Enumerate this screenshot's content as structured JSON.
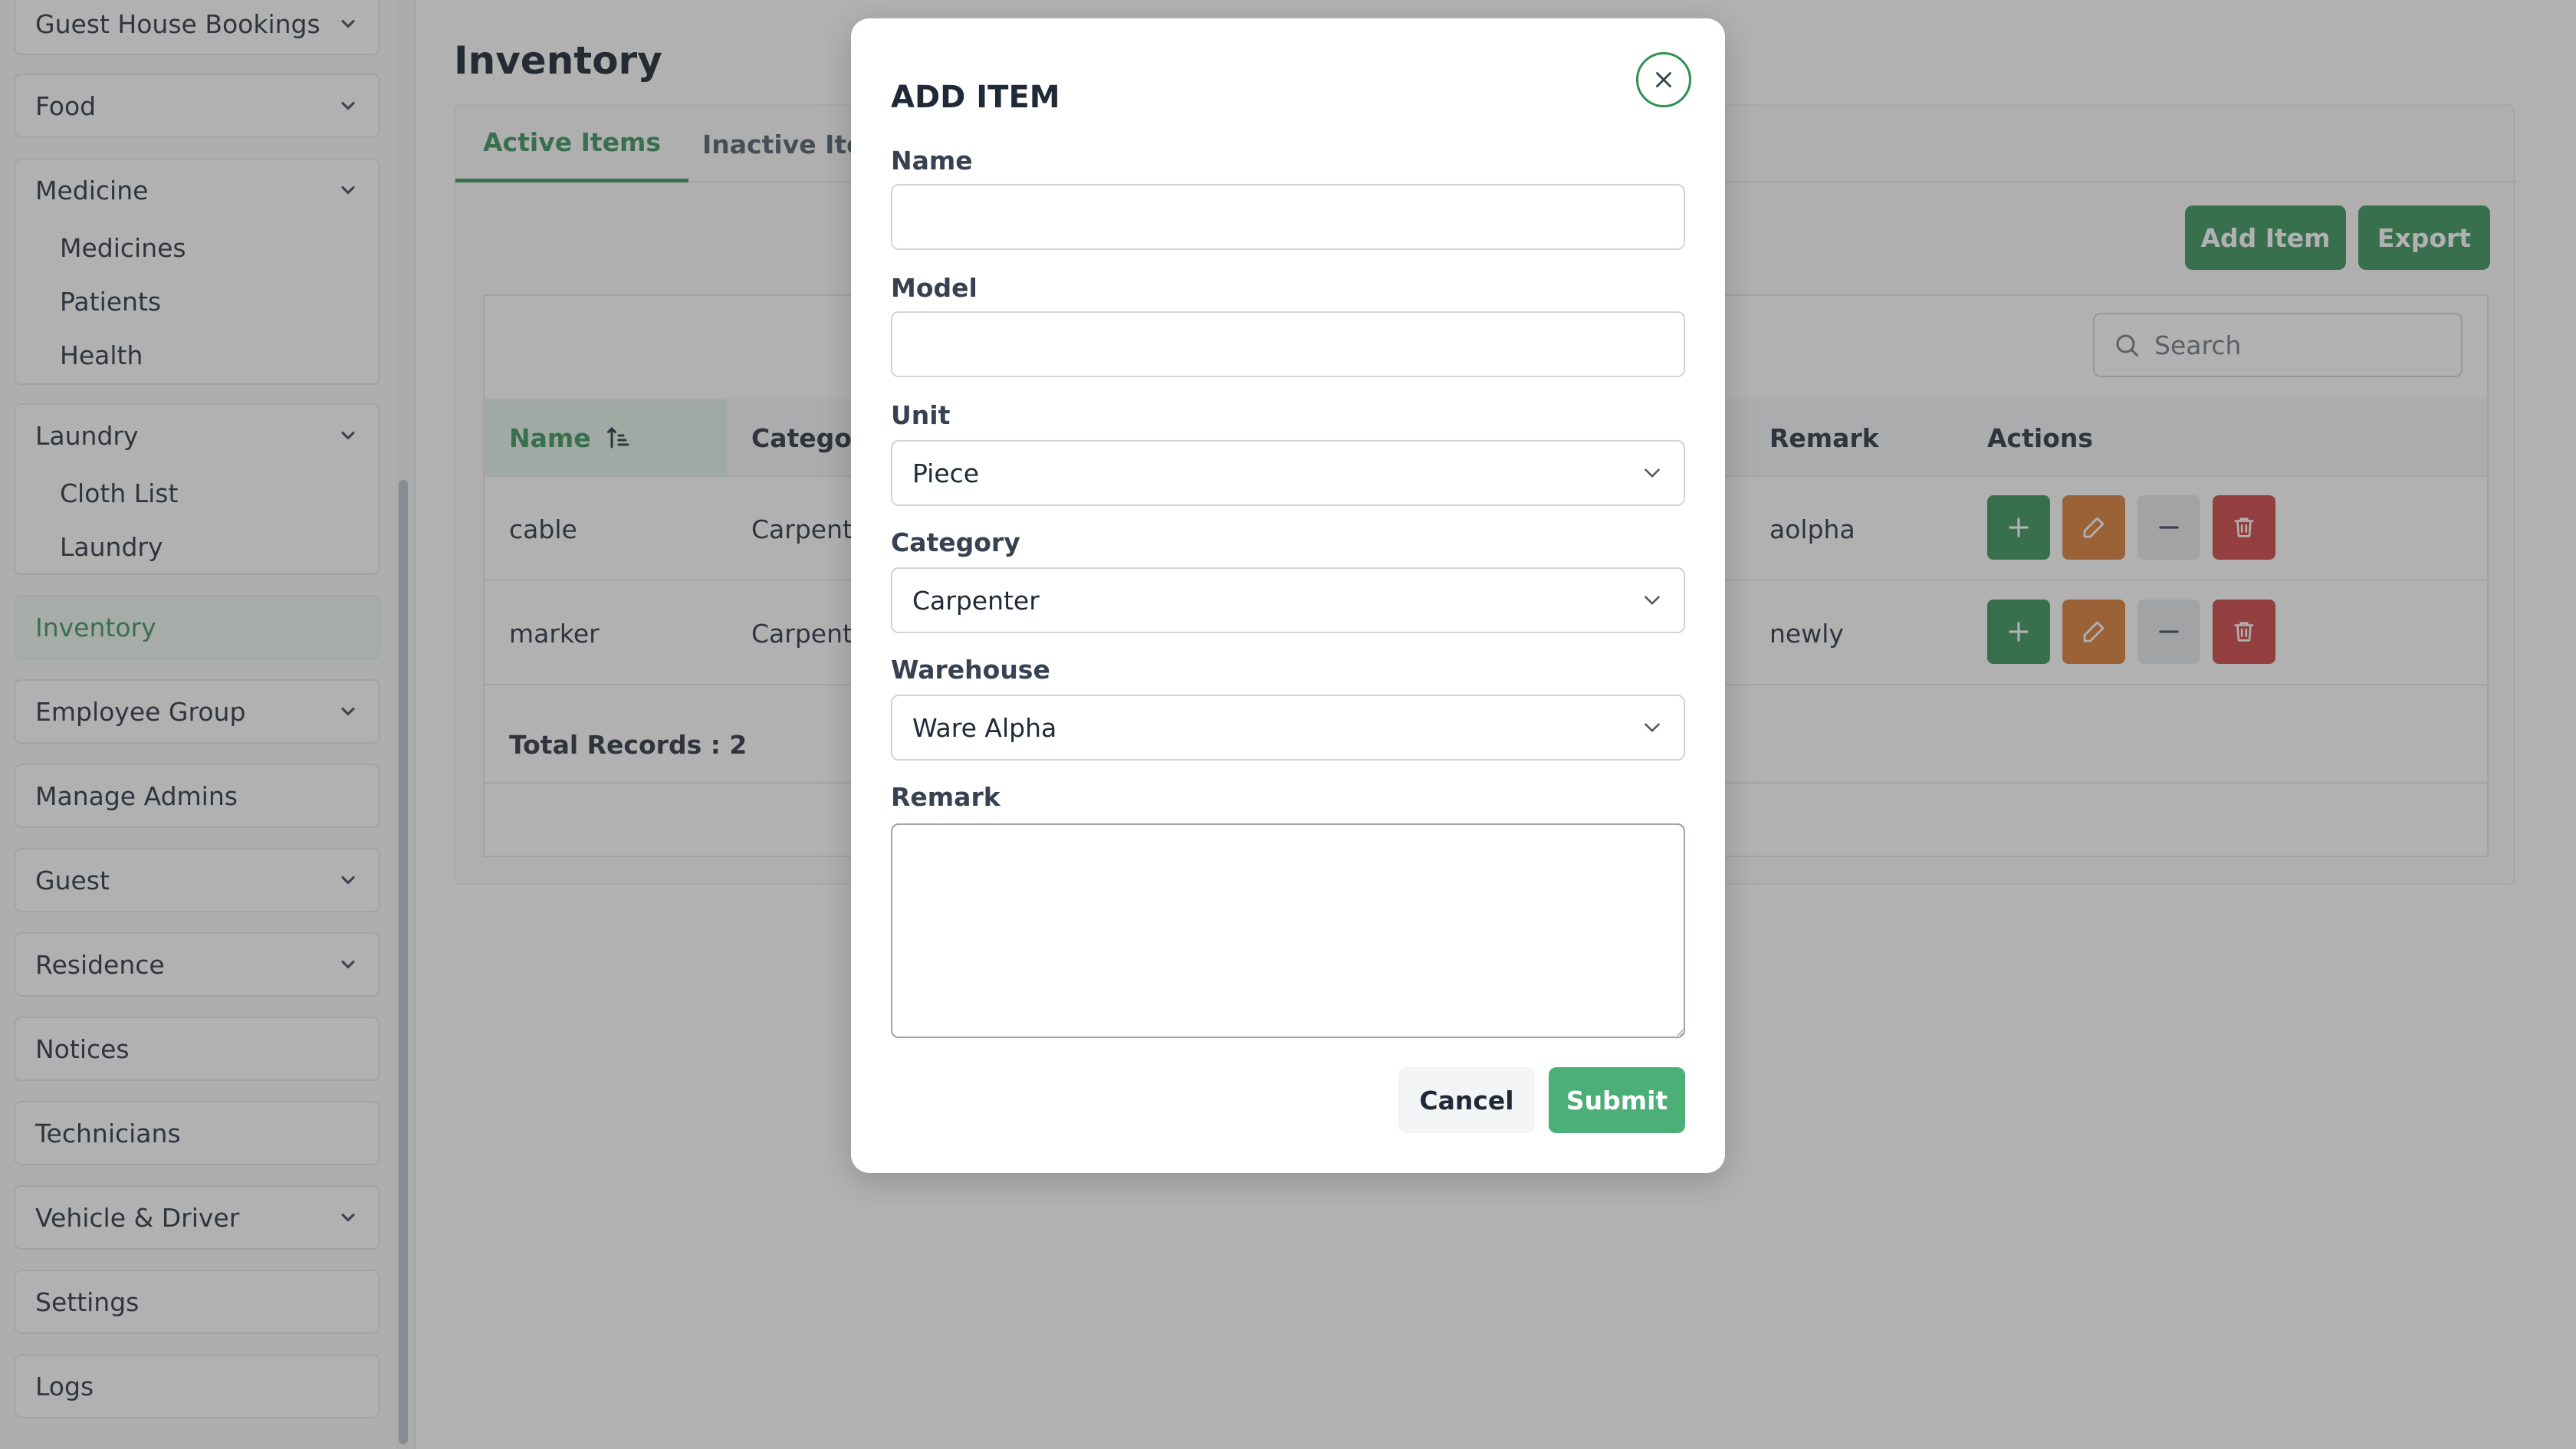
{
  "sidebar": {
    "groups": [
      {
        "label": "Guest House Bookings",
        "has_chevron": true
      },
      {
        "label": "Food",
        "has_chevron": true
      },
      {
        "label": "Medicine",
        "has_chevron": true,
        "children": [
          "Medicines",
          "Patients",
          "Health"
        ]
      },
      {
        "label": "Laundry",
        "has_chevron": true,
        "children": [
          "Cloth List",
          "Laundry"
        ]
      },
      {
        "label": "Inventory",
        "active": true
      },
      {
        "label": "Employee Group",
        "has_chevron": true
      },
      {
        "label": "Manage Admins"
      },
      {
        "label": "Guest",
        "has_chevron": true
      },
      {
        "label": "Residence",
        "has_chevron": true
      },
      {
        "label": "Notices"
      },
      {
        "label": "Technicians"
      },
      {
        "label": "Vehicle & Driver",
        "has_chevron": true
      },
      {
        "label": "Settings"
      },
      {
        "label": "Logs"
      }
    ]
  },
  "main": {
    "title": "Inventory",
    "tabs": [
      {
        "label": "Active Items",
        "active": true
      },
      {
        "label": "Inactive Items"
      }
    ],
    "buttons": {
      "add_item": "Add Item",
      "export": "Export"
    },
    "search": {
      "placeholder": "Search"
    },
    "table": {
      "columns": [
        "Name",
        "Category",
        "Remark",
        "Actions"
      ],
      "rows": [
        {
          "name": "cable",
          "category": "Carpenter",
          "remark": "aolpha"
        },
        {
          "name": "marker",
          "category": "Carpenter",
          "remark": "newly"
        }
      ],
      "total_label": "Total Records : 2"
    }
  },
  "modal": {
    "title": "ADD ITEM",
    "fields": {
      "name_label": "Name",
      "model_label": "Model",
      "unit_label": "Unit",
      "unit_value": "Piece",
      "category_label": "Category",
      "category_value": "Carpenter",
      "warehouse_label": "Warehouse",
      "warehouse_value": "Ware Alpha",
      "remark_label": "Remark"
    },
    "cancel_label": "Cancel",
    "submit_label": "Submit"
  },
  "colors": {
    "accent": "#2f8f55",
    "submit": "#4caf78",
    "edit": "#d9782d",
    "delete": "#cc3b3b",
    "disabled": "#e5e7eb"
  },
  "icons": [
    "chevron-down-icon",
    "sort-asc-icon",
    "search-icon",
    "plus-icon",
    "pencil-icon",
    "minus-icon",
    "trash-icon",
    "close-icon"
  ]
}
